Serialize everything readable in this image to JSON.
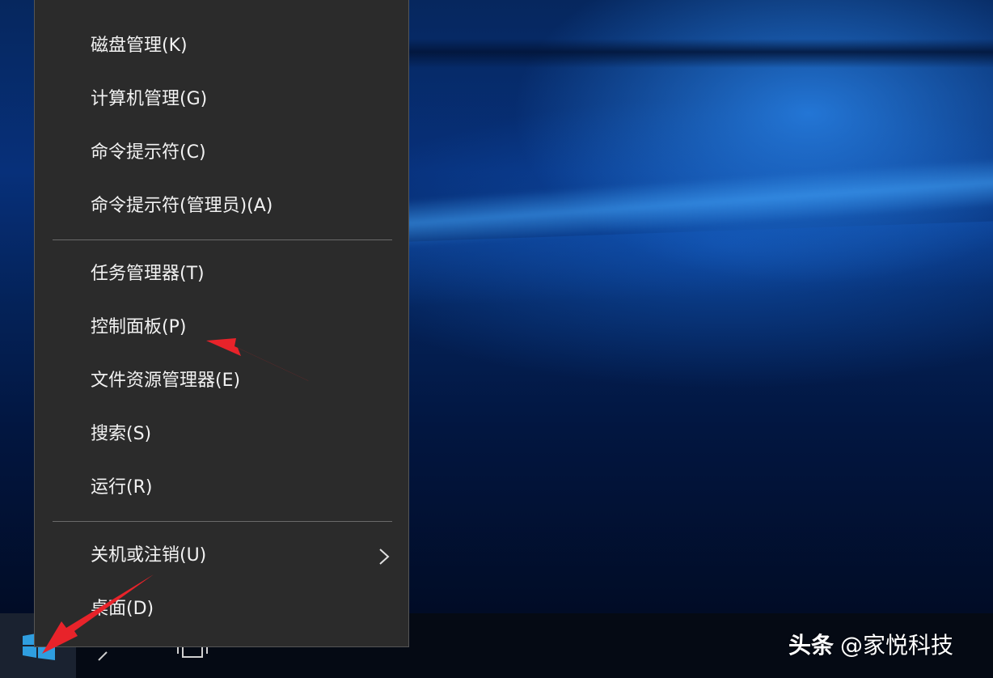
{
  "context_menu": {
    "items": [
      {
        "label": "磁盘管理(K)"
      },
      {
        "label": "计算机管理(G)"
      },
      {
        "label": "命令提示符(C)"
      },
      {
        "label": "命令提示符(管理员)(A)"
      },
      {
        "label": "任务管理器(T)"
      },
      {
        "label": "控制面板(P)"
      },
      {
        "label": "文件资源管理器(E)"
      },
      {
        "label": "搜索(S)"
      },
      {
        "label": "运行(R)"
      },
      {
        "label": "关机或注销(U)",
        "has_submenu": true
      },
      {
        "label": "桌面(D)"
      }
    ]
  },
  "watermark": {
    "brand": "头条",
    "account": "@家悦科技"
  },
  "colors": {
    "menu_background": "#2b2b2b",
    "menu_text": "#f2f2f2",
    "separator": "#6a6a6a",
    "annotation_arrow": "#e8232a",
    "windows_logo": "#2f9ee0",
    "taskbar": "#050a14"
  },
  "icons": {
    "start": "windows-logo-icon",
    "search": "search-icon",
    "task_view": "task-view-icon",
    "submenu": "chevron-right-icon"
  }
}
